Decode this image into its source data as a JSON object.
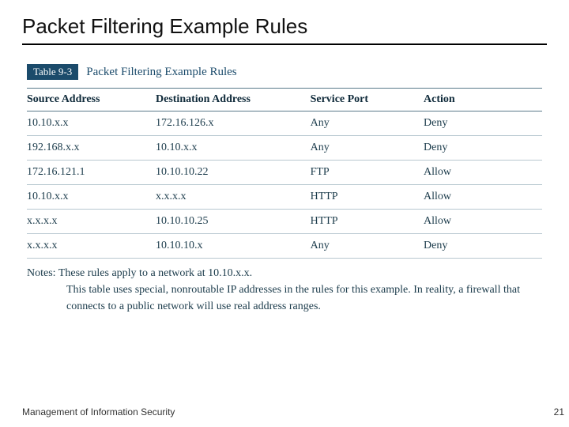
{
  "slide_title": "Packet Filtering Example Rules",
  "table_badge": "Table 9-3",
  "table_caption": "Packet Filtering Example Rules",
  "columns": {
    "source": "Source Address",
    "dest": "Destination Address",
    "port": "Service Port",
    "action": "Action"
  },
  "rows": [
    {
      "source": "10.10.x.x",
      "dest": "172.16.126.x",
      "port": "Any",
      "action": "Deny"
    },
    {
      "source": "192.168.x.x",
      "dest": "10.10.x.x",
      "port": "Any",
      "action": "Deny"
    },
    {
      "source": "172.16.121.1",
      "dest": "10.10.10.22",
      "port": "FTP",
      "action": "Allow"
    },
    {
      "source": "10.10.x.x",
      "dest": "x.x.x.x",
      "port": "HTTP",
      "action": "Allow"
    },
    {
      "source": "x.x.x.x",
      "dest": "10.10.10.25",
      "port": "HTTP",
      "action": "Allow"
    },
    {
      "source": "x.x.x.x",
      "dest": "10.10.10.x",
      "port": "Any",
      "action": "Deny"
    }
  ],
  "notes_label": "Notes:",
  "notes_line1": "These rules apply to a network at 10.10.x.x.",
  "notes_rest": "This table uses special, nonroutable IP addresses in the rules for this example. In reality, a firewall that connects to a public network will use real address ranges.",
  "footer_text": "Management of Information Security",
  "page_number": "21",
  "chart_data": {
    "type": "table",
    "title": "Packet Filtering Example Rules",
    "columns": [
      "Source Address",
      "Destination Address",
      "Service Port",
      "Action"
    ],
    "rows": [
      [
        "10.10.x.x",
        "172.16.126.x",
        "Any",
        "Deny"
      ],
      [
        "192.168.x.x",
        "10.10.x.x",
        "Any",
        "Deny"
      ],
      [
        "172.16.121.1",
        "10.10.10.22",
        "FTP",
        "Allow"
      ],
      [
        "10.10.x.x",
        "x.x.x.x",
        "HTTP",
        "Allow"
      ],
      [
        "x.x.x.x",
        "10.10.10.25",
        "HTTP",
        "Allow"
      ],
      [
        "x.x.x.x",
        "10.10.10.x",
        "Any",
        "Deny"
      ]
    ]
  }
}
